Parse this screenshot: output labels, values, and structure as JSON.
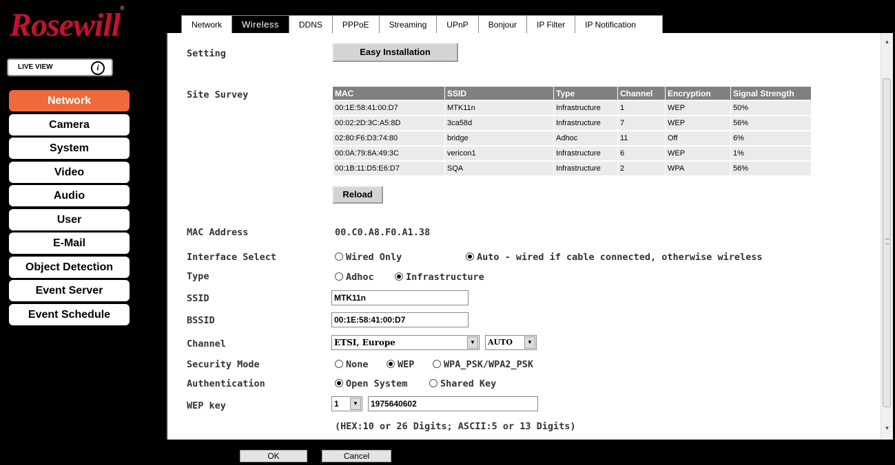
{
  "brand": {
    "logo_text": "Rosewill",
    "logo_mark": "®"
  },
  "live_view": {
    "label": "LIVE VIEW",
    "icon": "info-icon"
  },
  "sidebar": {
    "items": [
      {
        "label": "Network",
        "active": true
      },
      {
        "label": "Camera"
      },
      {
        "label": "System"
      },
      {
        "label": "Video"
      },
      {
        "label": "Audio"
      },
      {
        "label": "User"
      },
      {
        "label": "E-Mail"
      },
      {
        "label": "Object Detection"
      },
      {
        "label": "Event Server"
      },
      {
        "label": "Event Schedule"
      }
    ]
  },
  "tabs": [
    "Network",
    "Wireless",
    "DDNS",
    "PPPoE",
    "Streaming",
    "UPnP",
    "Bonjour",
    "IP Filter",
    "IP Notification"
  ],
  "active_tab": "Wireless",
  "setting": {
    "label": "Setting",
    "button": "Easy Installation"
  },
  "site_survey": {
    "label": "Site Survey",
    "columns": [
      "MAC",
      "SSID",
      "Type",
      "Channel",
      "Encryption",
      "Signal Strength"
    ],
    "rows": [
      [
        "00:1E:58:41:00:D7",
        "MTK11n",
        "Infrastructure",
        "1",
        "WEP",
        "50%"
      ],
      [
        "00:02:2D:3C:A5:8D",
        "3ca58d",
        "Infrastructure",
        "7",
        "WEP",
        "56%"
      ],
      [
        "02:80:F6:D3:74:80",
        "bridge",
        "Adhoc",
        "11",
        "Off",
        "6%"
      ],
      [
        "00:0A:79:8A:49:3C",
        "vericon1",
        "Infrastructure",
        "6",
        "WEP",
        "1%"
      ],
      [
        "00:1B:11:D5:E6:D7",
        "SQA",
        "Infrastructure",
        "2",
        "WPA",
        "56%"
      ]
    ],
    "reload_button": "Reload"
  },
  "mac_address": {
    "label": "MAC Address",
    "value": "00.C0.A8.F0.A1.38"
  },
  "interface_select": {
    "label": "Interface Select",
    "options": [
      "Wired Only",
      "Auto - wired if cable connected, otherwise wireless"
    ],
    "selected": 1
  },
  "type": {
    "label": "Type",
    "options": [
      "Adhoc",
      "Infrastructure"
    ],
    "selected": 1
  },
  "ssid": {
    "label": "SSID",
    "value": "MTK11n"
  },
  "bssid": {
    "label": "BSSID",
    "value": "00:1E:58:41:00:D7"
  },
  "channel": {
    "label": "Channel",
    "region": "ETSI, Europe",
    "channel": "AUTO"
  },
  "security_mode": {
    "label": "Security Mode",
    "options": [
      "None",
      "WEP",
      "WPA_PSK/WPA2_PSK"
    ],
    "selected": 1
  },
  "authentication": {
    "label": "Authentication",
    "options": [
      "Open System",
      "Shared Key"
    ],
    "selected": 0
  },
  "wep_key": {
    "label": "WEP key",
    "index": "1",
    "value": "1975640602",
    "hint": "(HEX:10 or 26 Digits; ASCII:5 or 13 Digits)"
  },
  "footer": {
    "ok": "OK",
    "cancel": "Cancel"
  },
  "colors": {
    "accent": "#ee6a3c",
    "brand_red": "#c8102e",
    "header_gray": "#808080"
  }
}
